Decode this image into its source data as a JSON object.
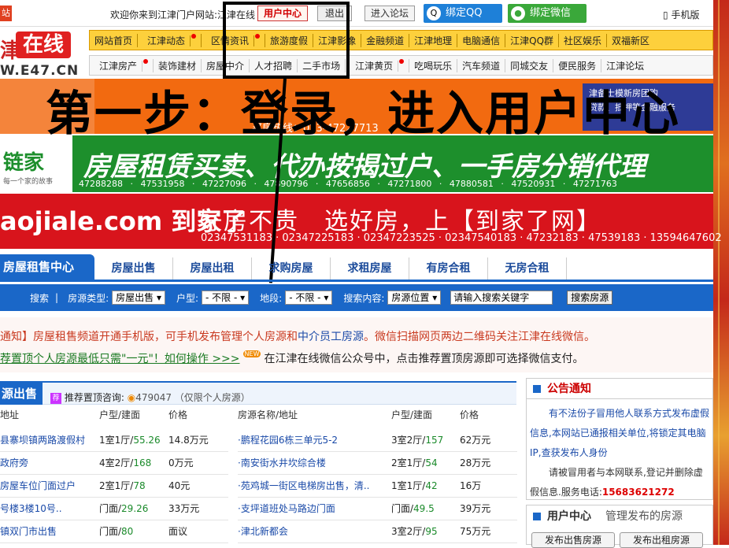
{
  "topbar": {
    "left_badge": "站",
    "welcome": "欢迎你来到江津门户网站:江津在线",
    "user_center": "用户中心",
    "logout": "退出",
    "forum": "进入论坛",
    "bind_qq": "绑定QQ",
    "bind_wechat": "绑定微信",
    "mobile": "手机版"
  },
  "logo": {
    "char": "津",
    "zaixian": "在线",
    "url": "W.E47.CN"
  },
  "nav_primary": [
    "网站首页",
    "江津动态",
    "区情资讯",
    "旅游度假",
    "江津影像",
    "金融频道",
    "江津地理",
    "电脑通信",
    "江津QQ群",
    "社区娱乐",
    "双福新区"
  ],
  "nav_secondary": [
    "江津房产",
    "装饰建材",
    "房屋中介",
    "人才招聘",
    "二手市场",
    "江津黄页",
    "吃喝玩乐",
    "汽车频道",
    "同城交友",
    "便民服务",
    "江津论坛"
  ],
  "overlay_text": "第一步：登录，进入用户中心",
  "banners": {
    "b1_phone": "买房热线：023-47227713",
    "b1_right_line1": "津备士模新房团购",
    "b1_right_line2": "贷款、抵押等金融服务",
    "b2_logo": "链家",
    "b2_logo_sub": "每一个家的故事",
    "b2_title": "房屋租赁买卖、代办按揭过户、一手房分销代理",
    "b2_phones": "47288288 · 47531958 · 47227096 · 47890796 · 47656856 · 47271800 · 47880581 · 47520931 · 47271763",
    "b3_brand": "aojiale.com 到家了",
    "b3_slogan": "好房不贵　选好房，上【到家了网】",
    "b3_phones": "02347531183 · 02347225183 · 02347223525 · 02347540183 · 47232183 · 47539183 · 13594647602"
  },
  "tabs": {
    "active": "房屋租售中心",
    "items": [
      "房屋出售",
      "房屋出租",
      "求购房屋",
      "求租房屋",
      "有房合租",
      "无房合租"
    ]
  },
  "search": {
    "search_label": "搜索",
    "type_label": "房源类型:",
    "type_value": "房屋出售",
    "huxing_label": "户型:",
    "huxing_value": "- 不限 -",
    "district_label": "地段:",
    "district_value": "- 不限 -",
    "content_label": "搜索内容:",
    "content_value": "房源位置",
    "keyword_placeholder": "请输入搜索关键字",
    "button": "搜索房源"
  },
  "notices": {
    "line1_a": "通知】房屋租售频道开通手机版，可手机发布管理个人房源和",
    "line1_link": "中介员工房源",
    "line1_b": "。微信扫描网页两边二维码关注江津在线微信。",
    "line2_link": "荐置顶个人房源最低只需\"一元\"！如何操作 >>>",
    "line2_new": "NEW",
    "line2_b": "在江津在线微信公众号中，点击推荐置顶房源即可选择微信支付。"
  },
  "list": {
    "title": "源出售",
    "tip_icon": "荐",
    "tip": "推荐置顶咨询:",
    "tip_qq": "479047 （仅限个人房源）",
    "left_cols": [
      "地址",
      "户型/建面",
      "价格"
    ],
    "right_cols": [
      "房源名称/地址",
      "户型/建面",
      "价格"
    ],
    "left_rows": [
      {
        "name": "县寨坝镇两路渡假村",
        "room": "1室1厅/",
        "area": "55.26",
        "price": "14.8万元"
      },
      {
        "name": "政府旁",
        "room": "4室2厅/",
        "area": "168",
        "price": "0万元"
      },
      {
        "name": "房屋车位门面过户",
        "room": "2室1厅/",
        "area": "78",
        "price": "40元"
      },
      {
        "name": "号楼3楼10号..",
        "room": "门面/",
        "area": "29.26",
        "price": "33万元"
      },
      {
        "name": "镇双门市出售",
        "room": "门面/",
        "area": "80",
        "price": "面议"
      }
    ],
    "right_rows": [
      {
        "name": "·鹏程花园6栋三单元5-2",
        "room": "3室2厅/",
        "area": "157",
        "price": "62万元"
      },
      {
        "name": "·南安街水井坎综合楼",
        "room": "2室1厅/",
        "area": "54",
        "price": "28万元"
      },
      {
        "name": "·苑鸡城一街区电梯房出售，清..",
        "room": "1室1厅/",
        "area": "42",
        "price": "16万"
      },
      {
        "name": "·支坪道班处马路边门面",
        "room": "门面/",
        "area": "49.5",
        "price": "39万元"
      },
      {
        "name": "·津北新都会",
        "room": "3室2厅/",
        "area": "95",
        "price": "75万元"
      }
    ]
  },
  "sidebar": {
    "notice_title": "公告通知",
    "notice_text1": "有不法份子冒用他人联系方式发布虚假信息,本网站已通报相关单位,将锁定其电脑IP,查获发布人身份",
    "notice_text2": "请被冒用者与本网联系,登记并删除虚假信息.服务电话:",
    "notice_tel": "15683621272",
    "user_center": "用户中心",
    "manage": "管理发布的房源",
    "btn_sale": "发布出售房源",
    "btn_rent": "发布出租房源"
  },
  "colors": {
    "blue": "#1a67c8",
    "red_highlight": "#d20000",
    "nav_yellow": "#fdd03c"
  }
}
